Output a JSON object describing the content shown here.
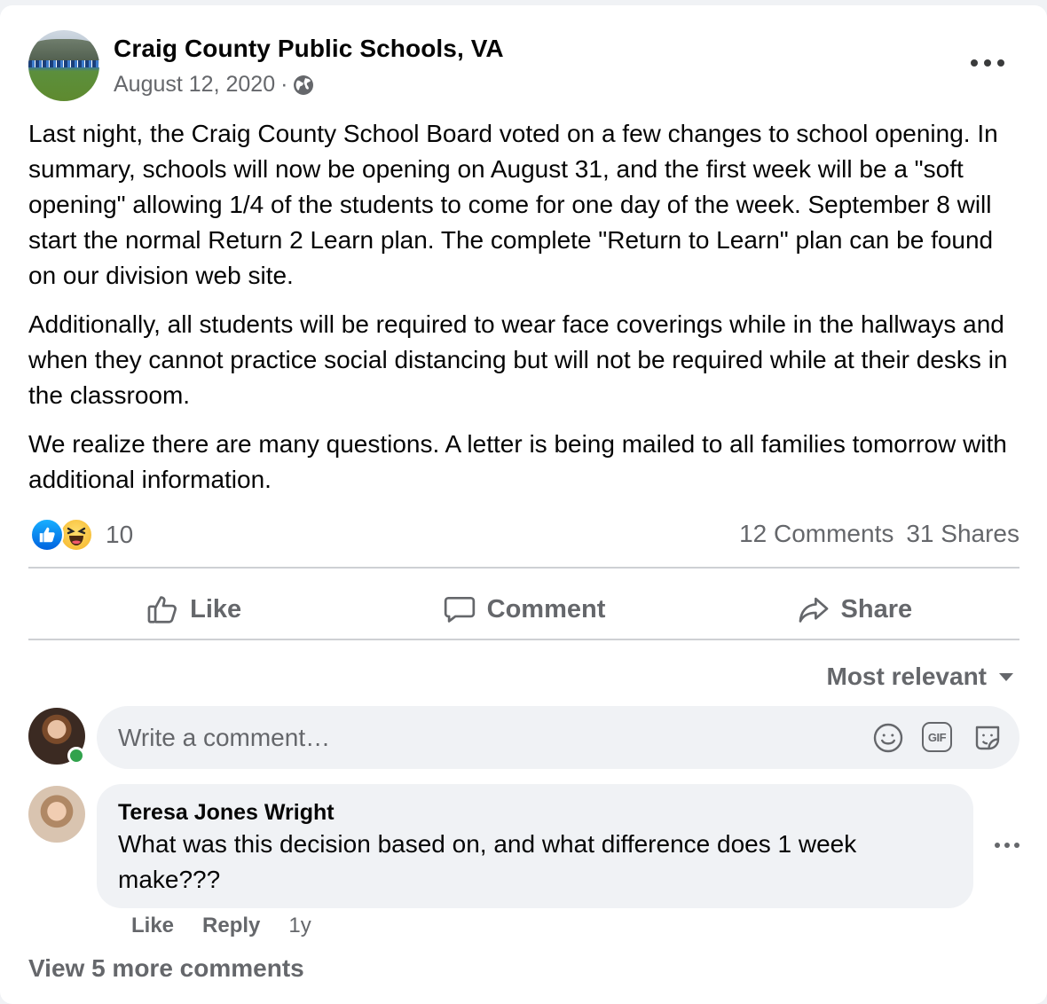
{
  "post": {
    "page_name": "Craig County Public Schools, VA",
    "date": "August 12, 2020",
    "date_separator": "·",
    "privacy_icon": "globe-icon",
    "paragraphs": [
      "Last night, the Craig County School Board voted on a few changes to school opening. In summary, schools will now be opening on August 31, and the first week will be a \"soft opening\" allowing 1/4 of the students to come for one day of the week. September 8 will start the normal Return 2 Learn plan. The complete \"Return to Learn\" plan can be found on our division web site.",
      "Additionally, all students will be required to wear face coverings while in the hallways and when they cannot practice social distancing but will not be required while at their desks in the classroom.",
      "We realize there are many questions. A letter is being mailed to all families tomorrow with additional information."
    ]
  },
  "reactions": {
    "types": [
      "like",
      "haha"
    ],
    "count": "10",
    "comments": "12 Comments",
    "shares": "31 Shares"
  },
  "actions": {
    "like": "Like",
    "comment": "Comment",
    "share": "Share"
  },
  "sort": {
    "label": "Most relevant"
  },
  "composer": {
    "placeholder": "Write a comment…",
    "icons": [
      "emoji-icon",
      "gif-icon",
      "sticker-icon"
    ],
    "gif_text": "GIF"
  },
  "comment": {
    "author": "Teresa Jones Wright",
    "text": "What was this decision based on, and what difference does 1 week make???",
    "like": "Like",
    "reply": "Reply",
    "time": "1y"
  },
  "view_more": "View 5 more comments",
  "colors": {
    "text": "#050505",
    "secondary": "#65676b",
    "like_blue": "#1877f2",
    "bubble_bg": "#f0f2f5",
    "online_green": "#31a24c"
  }
}
